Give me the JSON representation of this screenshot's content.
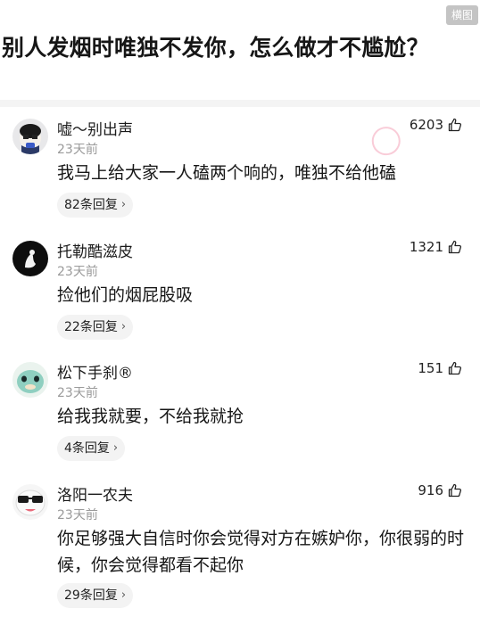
{
  "header": {
    "badge": "横图",
    "title": "别人发烟时唯独不发你，怎么做才不尴尬？"
  },
  "comments": [
    {
      "username": "嘘～别出声",
      "time": "23天前",
      "likes": "6203",
      "text": "我马上给大家一人磕两个响的，唯独不给他磕",
      "replies": "82条回复"
    },
    {
      "username": "托勒酷滋皮",
      "time": "23天前",
      "likes": "1321",
      "text": "捡他们的烟屁股吸",
      "replies": "22条回复"
    },
    {
      "username": "松下手刹®",
      "time": "23天前",
      "likes": "151",
      "text": "给我我就要，不给我就抢",
      "replies": "4条回复"
    },
    {
      "username": "洛阳一农夫",
      "time": "23天前",
      "likes": "916",
      "text": "你足够强大自信时你会觉得对方在嫉妒你，你很弱的时候，你会觉得都看不起你",
      "replies": "29条回复"
    }
  ],
  "icons": {
    "like": "thumbs-up-icon",
    "chevron": "chevron-right-icon"
  }
}
